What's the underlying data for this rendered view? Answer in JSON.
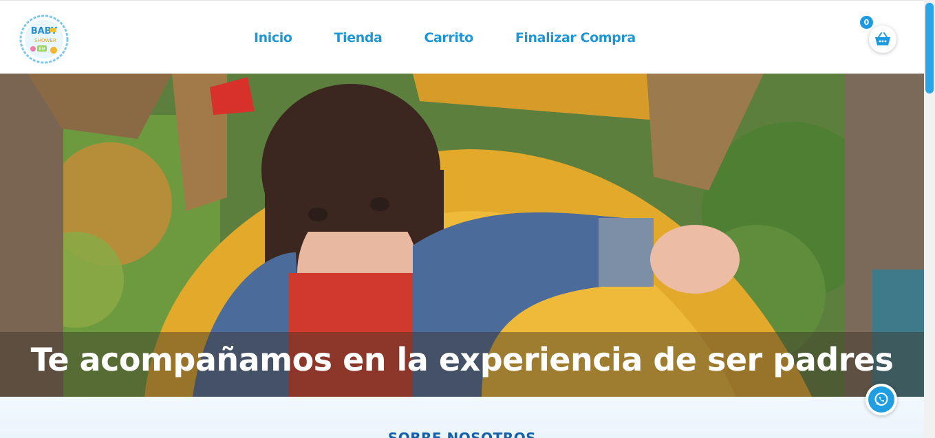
{
  "brand": {
    "logo_text_1": "BABY",
    "logo_text_2": "SHOWER",
    "logo_text_3": "BM"
  },
  "nav": {
    "items": [
      {
        "label": "Inicio"
      },
      {
        "label": "Tienda"
      },
      {
        "label": "Carrito"
      },
      {
        "label": "Finalizar Compra"
      }
    ]
  },
  "cart": {
    "count": "0",
    "icon": "basket-icon"
  },
  "hero": {
    "title": "Te acompañamos en la experiencia de ser padres"
  },
  "about": {
    "title": "SOBRE NOSOTROS"
  },
  "whatsapp": {
    "icon": "whatsapp-icon"
  },
  "colors": {
    "accent": "#1f97d6",
    "badge": "#1d9be0",
    "scrollbar": "#2aa6e8"
  }
}
